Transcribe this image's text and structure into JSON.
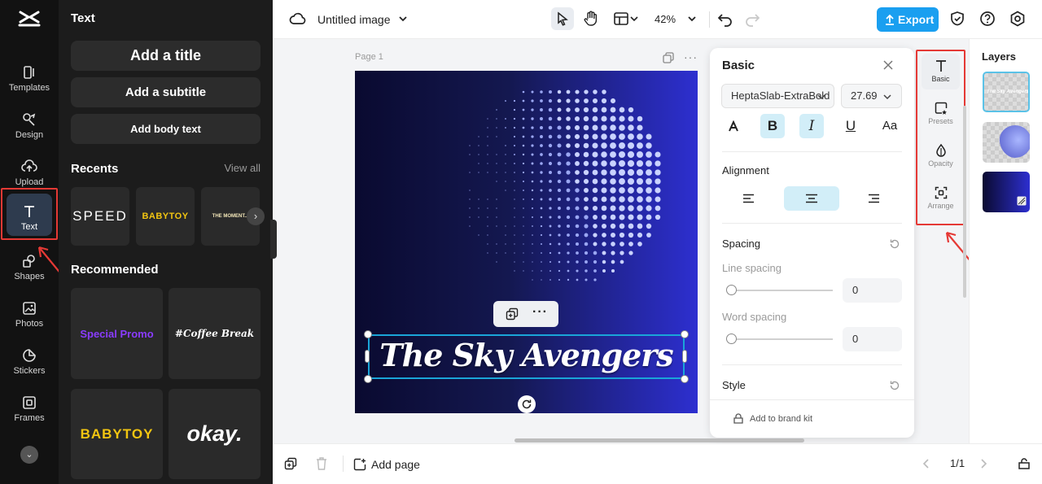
{
  "rail": {
    "items": [
      {
        "label": "Templates",
        "icon": "templates-icon"
      },
      {
        "label": "Design",
        "icon": "design-icon"
      },
      {
        "label": "Upload",
        "icon": "upload-icon"
      },
      {
        "label": "Text",
        "icon": "text-icon"
      },
      {
        "label": "Shapes",
        "icon": "shapes-icon"
      },
      {
        "label": "Photos",
        "icon": "photos-icon"
      },
      {
        "label": "Stickers",
        "icon": "stickers-icon"
      },
      {
        "label": "Frames",
        "icon": "frames-icon"
      }
    ]
  },
  "panel": {
    "title": "Text",
    "add_title": "Add a title",
    "add_subtitle": "Add a subtitle",
    "add_body": "Add body text",
    "recents_label": "Recents",
    "view_all": "View all",
    "recents": [
      "SPEED",
      "BABYTOY",
      "THE MOMENT..."
    ],
    "recommended_label": "Recommended",
    "recommended": [
      "Special Promo",
      "#Coffee Break",
      "BABYTOY",
      "okay."
    ]
  },
  "topbar": {
    "doc_title": "Untitled image",
    "zoom": "42%",
    "export_label": "Export"
  },
  "canvas": {
    "page_label": "Page 1",
    "headline": "The Sky Avengers"
  },
  "props": {
    "title": "Basic",
    "font": "HeptaSlab-ExtraBold",
    "font_size": "27.69",
    "alignment_label": "Alignment",
    "spacing_label": "Spacing",
    "line_spacing_label": "Line spacing",
    "line_spacing_value": "0",
    "word_spacing_label": "Word spacing",
    "word_spacing_value": "0",
    "style_label": "Style",
    "brand_kit": "Add to brand kit"
  },
  "tools": {
    "items": [
      {
        "label": "Basic",
        "icon": "text-icon"
      },
      {
        "label": "Presets",
        "icon": "presets-icon"
      },
      {
        "label": "Opacity",
        "icon": "opacity-icon"
      },
      {
        "label": "Arrange",
        "icon": "arrange-icon"
      }
    ]
  },
  "layers": {
    "title": "Layers",
    "layer1_text": "The Sky Avengers"
  },
  "bottom": {
    "add_page": "Add page",
    "page_count": "1/1"
  },
  "colors": {
    "accent": "#1a9ff0",
    "highlight": "#e53935",
    "selection": "#1aa5d8",
    "active_toggle": "#d2eef8"
  }
}
